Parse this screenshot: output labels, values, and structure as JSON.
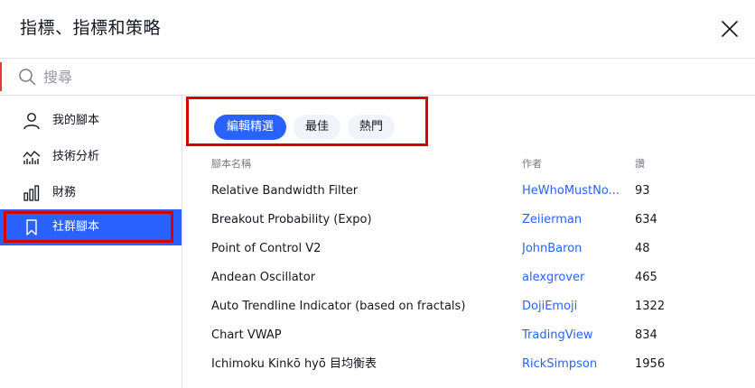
{
  "dialog": {
    "title": "指標、指標和策略",
    "close_icon": "close-icon"
  },
  "search": {
    "placeholder": "搜尋",
    "icon": "search-icon"
  },
  "sidebar": {
    "items": [
      {
        "label": "我的腳本",
        "icon": "user-icon",
        "active": false
      },
      {
        "label": "技術分析",
        "icon": "chart-line-icon",
        "active": false
      },
      {
        "label": "財務",
        "icon": "bar-chart-icon",
        "active": false
      },
      {
        "label": "社群腳本",
        "icon": "bookmark-icon",
        "active": true
      }
    ]
  },
  "tabs": [
    {
      "label": "編輯精選",
      "active": true
    },
    {
      "label": "最佳",
      "active": false
    },
    {
      "label": "熱門",
      "active": false
    }
  ],
  "table": {
    "headers": {
      "name": "腳本名稱",
      "author": "作者",
      "likes": "讚"
    },
    "rows": [
      {
        "name": "Relative Bandwidth Filter",
        "author": "HeWhoMustNo...",
        "likes": "93"
      },
      {
        "name": "Breakout Probability (Expo)",
        "author": "Zeiierman",
        "likes": "634"
      },
      {
        "name": "Point of Control V2",
        "author": "JohnBaron",
        "likes": "48"
      },
      {
        "name": "Andean Oscillator",
        "author": "alexgrover",
        "likes": "465"
      },
      {
        "name": "Auto Trendline Indicator (based on fractals)",
        "author": "DojiEmoji",
        "likes": "1322"
      },
      {
        "name": "Chart VWAP",
        "author": "TradingView",
        "likes": "834"
      },
      {
        "name": "Ichimoku Kinkō hyō 目均衡表",
        "author": "RickSimpson",
        "likes": "1956"
      }
    ]
  },
  "colors": {
    "accent": "#2962ff",
    "highlight_border": "#d50000",
    "text": "#131722",
    "muted": "#787b86"
  }
}
